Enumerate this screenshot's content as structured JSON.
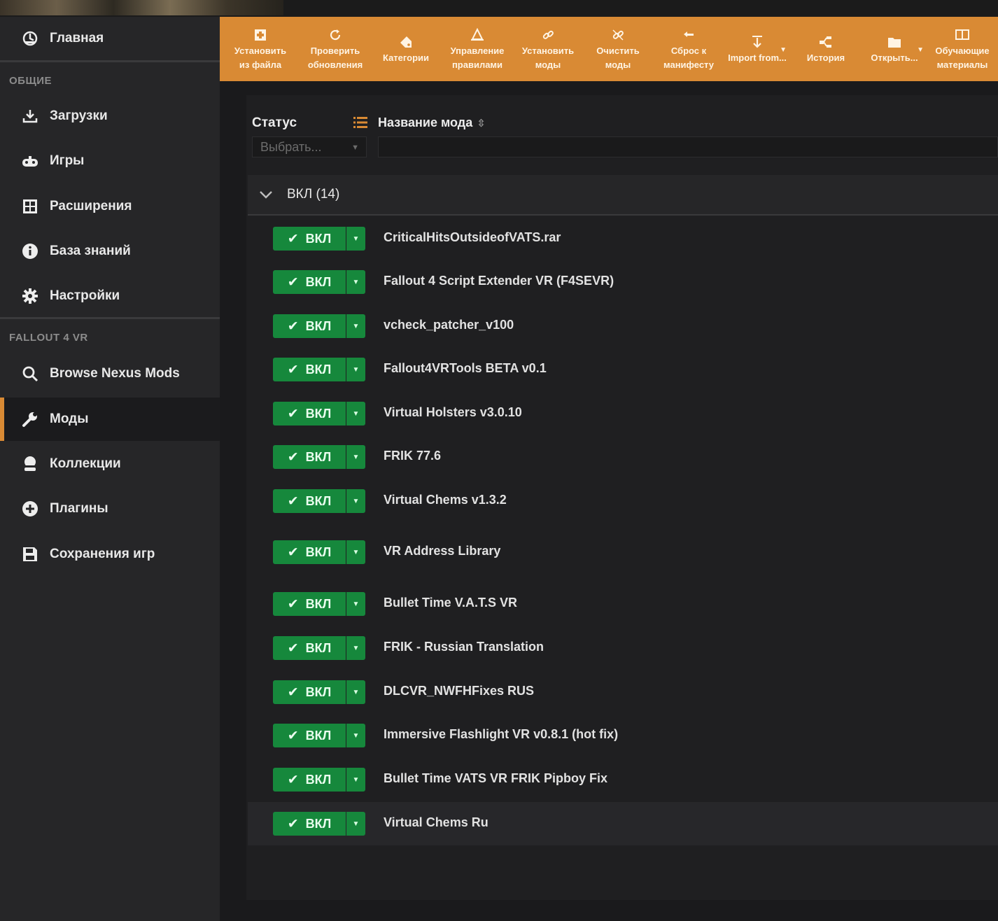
{
  "sidebar": {
    "home": "Главная",
    "section_general": "ОБЩИЕ",
    "general_items": [
      {
        "label": "Загрузки",
        "icon": "download-icon"
      },
      {
        "label": "Игры",
        "icon": "gamepad-icon"
      },
      {
        "label": "Расширения",
        "icon": "extensions-icon"
      },
      {
        "label": "База знаний",
        "icon": "info-icon"
      },
      {
        "label": "Настройки",
        "icon": "gear-icon"
      }
    ],
    "section_game": "FALLOUT 4 VR",
    "game_items": [
      {
        "label": "Browse Nexus Mods",
        "icon": "search-icon"
      },
      {
        "label": "Моды",
        "icon": "wrench-icon",
        "active": true
      },
      {
        "label": "Коллекции",
        "icon": "collections-icon"
      },
      {
        "label": "Плагины",
        "icon": "plugin-icon"
      },
      {
        "label": "Сохранения игр",
        "icon": "save-icon"
      }
    ]
  },
  "toolbar": {
    "buttons": [
      {
        "label": "Установить из файла",
        "icon": "install-file-icon"
      },
      {
        "label": "Проверить обновления",
        "icon": "refresh-icon"
      },
      {
        "label": "Категории",
        "icon": "tag-icon"
      },
      {
        "label": "Управление правилами",
        "icon": "rules-icon"
      },
      {
        "label": "Установить моды",
        "icon": "link-icon"
      },
      {
        "label": "Очистить моды",
        "icon": "purge-icon"
      },
      {
        "label": "Сброс к манифесту",
        "icon": "reset-icon"
      },
      {
        "label": "Import from...",
        "icon": "import-icon",
        "dropdown": true
      },
      {
        "label": "История",
        "icon": "history-icon"
      },
      {
        "label": "Открыть...",
        "icon": "folder-icon",
        "dropdown": true
      },
      {
        "label": "Обучающие материалы",
        "icon": "tutorial-icon"
      }
    ]
  },
  "table": {
    "status_header": "Статус",
    "status_filter_placeholder": "Выбрать...",
    "name_header": "Название мода",
    "group_label": "ВКЛ (14)"
  },
  "toggle_label": "ВКЛ",
  "accent_color": "#d98a34",
  "enabled_color": "#16883c",
  "mods": [
    {
      "name": "CriticalHitsOutsideofVATS.rar"
    },
    {
      "name": "Fallout 4 Script Extender VR (F4SEVR)"
    },
    {
      "name": "vcheck_patcher_v100"
    },
    {
      "name": "Fallout4VRTools BETA v0.1"
    },
    {
      "name": "Virtual Holsters v3.0.10"
    },
    {
      "name": "FRIK 77.6"
    },
    {
      "name": "Virtual Chems v1.3.2"
    },
    {
      "name": "VR Address Library"
    },
    {
      "name": "Bullet Time V.A.T.S VR"
    },
    {
      "name": "FRIK - Russian Translation"
    },
    {
      "name": "DLCVR_NWFHFixes RUS"
    },
    {
      "name": "Immersive Flashlight VR v0.8.1 (hot fix)"
    },
    {
      "name": "Bullet Time VATS VR FRIK Pipboy Fix"
    },
    {
      "name": "Virtual Chems Ru",
      "selected": true
    }
  ]
}
